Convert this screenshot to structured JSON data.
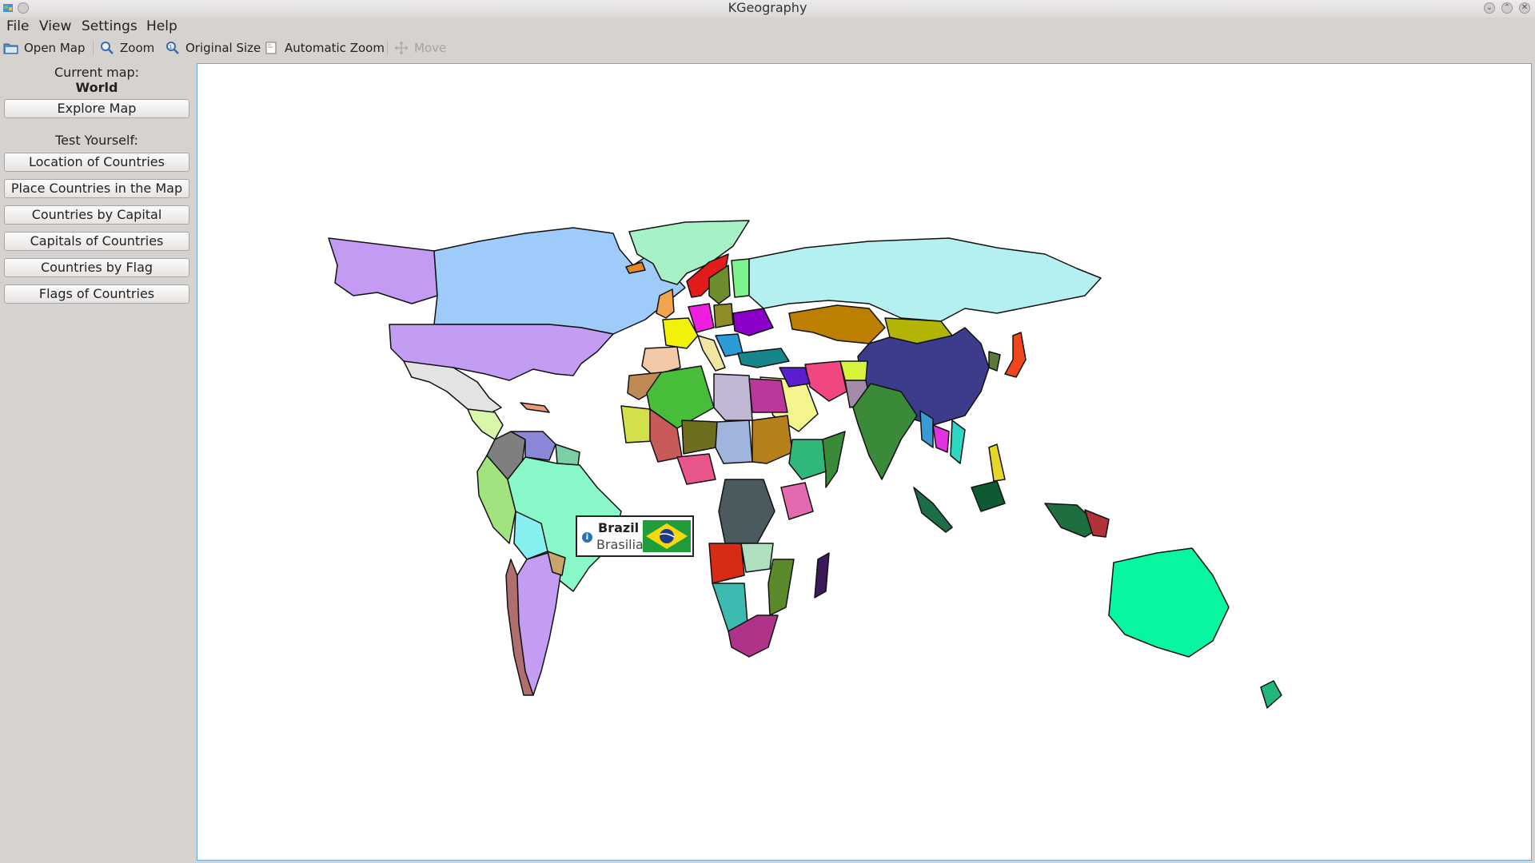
{
  "window": {
    "title": "KGeography"
  },
  "menu": [
    "File",
    "View",
    "Settings",
    "Help"
  ],
  "toolbar": {
    "open_map": "Open Map",
    "zoom": "Zoom",
    "original_size": "Original Size",
    "automatic_zoom": "Automatic Zoom",
    "move": "Move"
  },
  "sidebar": {
    "current_map_label": "Current map:",
    "current_map": "World",
    "explore_button": "Explore Map",
    "test_label": "Test Yourself:",
    "tests": [
      "Location of Countries",
      "Place Countries in the Map",
      "Countries by Capital",
      "Capitals of Countries",
      "Countries by Flag",
      "Flags of Countries"
    ]
  },
  "popup": {
    "country": "Brazil",
    "capital": "Brasilia",
    "flag_colors": {
      "field": "#1f9d3b",
      "diamond": "#f6d80e",
      "globe": "#1e3a8a"
    }
  },
  "icons": {
    "open_map": "open-folder-icon",
    "zoom": "zoom-icon",
    "original_size": "zoom-original-icon",
    "automatic_zoom": "auto-zoom-icon",
    "move": "move-icon"
  }
}
